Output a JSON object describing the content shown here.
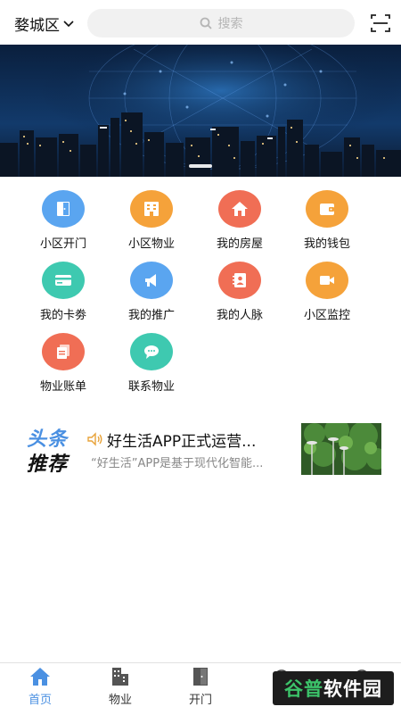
{
  "header": {
    "city": "婺城区",
    "search_placeholder": "搜索"
  },
  "grid": [
    {
      "label": "小区开门",
      "icon": "door-icon",
      "color": "#5aa5f0"
    },
    {
      "label": "小区物业",
      "icon": "building-icon",
      "color": "#f5a23a"
    },
    {
      "label": "我的房屋",
      "icon": "home-icon",
      "color": "#f06e55"
    },
    {
      "label": "我的钱包",
      "icon": "wallet-icon",
      "color": "#f5a23a"
    },
    {
      "label": "我的卡劵",
      "icon": "card-icon",
      "color": "#3ec9b0"
    },
    {
      "label": "我的推广",
      "icon": "megaphone-icon",
      "color": "#5aa5f0"
    },
    {
      "label": "我的人脉",
      "icon": "contacts-icon",
      "color": "#f06e55"
    },
    {
      "label": "小区监控",
      "icon": "camera-icon",
      "color": "#f5a23a"
    },
    {
      "label": "物业账单",
      "icon": "bill-icon",
      "color": "#f06e55"
    },
    {
      "label": "联系物业",
      "icon": "chat-icon",
      "color": "#3ec9b0"
    }
  ],
  "headlines": {
    "brand_line1": "头条",
    "brand_line2": "推荐",
    "title": "好生活APP正式运营...",
    "subtitle": "“好生活”APP是基于现代化智能..."
  },
  "nav": [
    {
      "label": "首页",
      "icon": "home-icon",
      "active": true
    },
    {
      "label": "物业",
      "icon": "building-icon",
      "active": false
    },
    {
      "label": "开门",
      "icon": "door-icon",
      "active": false
    }
  ],
  "watermark": {
    "part1": "谷普",
    "part2": "软件园",
    "color1": "#3cc46a",
    "color2": "#ffffff"
  },
  "colors": {
    "accent": "#4a90e2"
  }
}
